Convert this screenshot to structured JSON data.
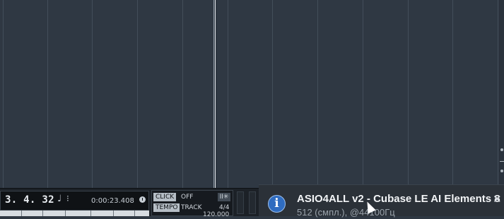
{
  "transport": {
    "bars_position": "3. 4. 32",
    "note_icon": "quarter-note-icon",
    "metronome_icon": "metronome-icon",
    "time_position": "0:00:23.408",
    "clock_icon": "clock-icon",
    "click": {
      "label": "CLICK",
      "value": "OFF",
      "sync_label": "II✳"
    },
    "tempo": {
      "label": "TEMPO",
      "value": "TRACK",
      "signature": "4/4",
      "bpm": "120.000"
    }
  },
  "notification": {
    "icon": "info-icon",
    "icon_glyph": "i",
    "title": "ASIO4ALL v2 - Cubase LE AI Elements 8",
    "subtitle": "512 (смпл.), @44100Гц",
    "close_glyph": "✕"
  },
  "colors": {
    "arrange_bg": "#2f3843",
    "gridline": "#434e5a",
    "playhead": "#e8ecf0",
    "notification_bg": "#2b3138",
    "info_blue": "#2f6cc0"
  }
}
